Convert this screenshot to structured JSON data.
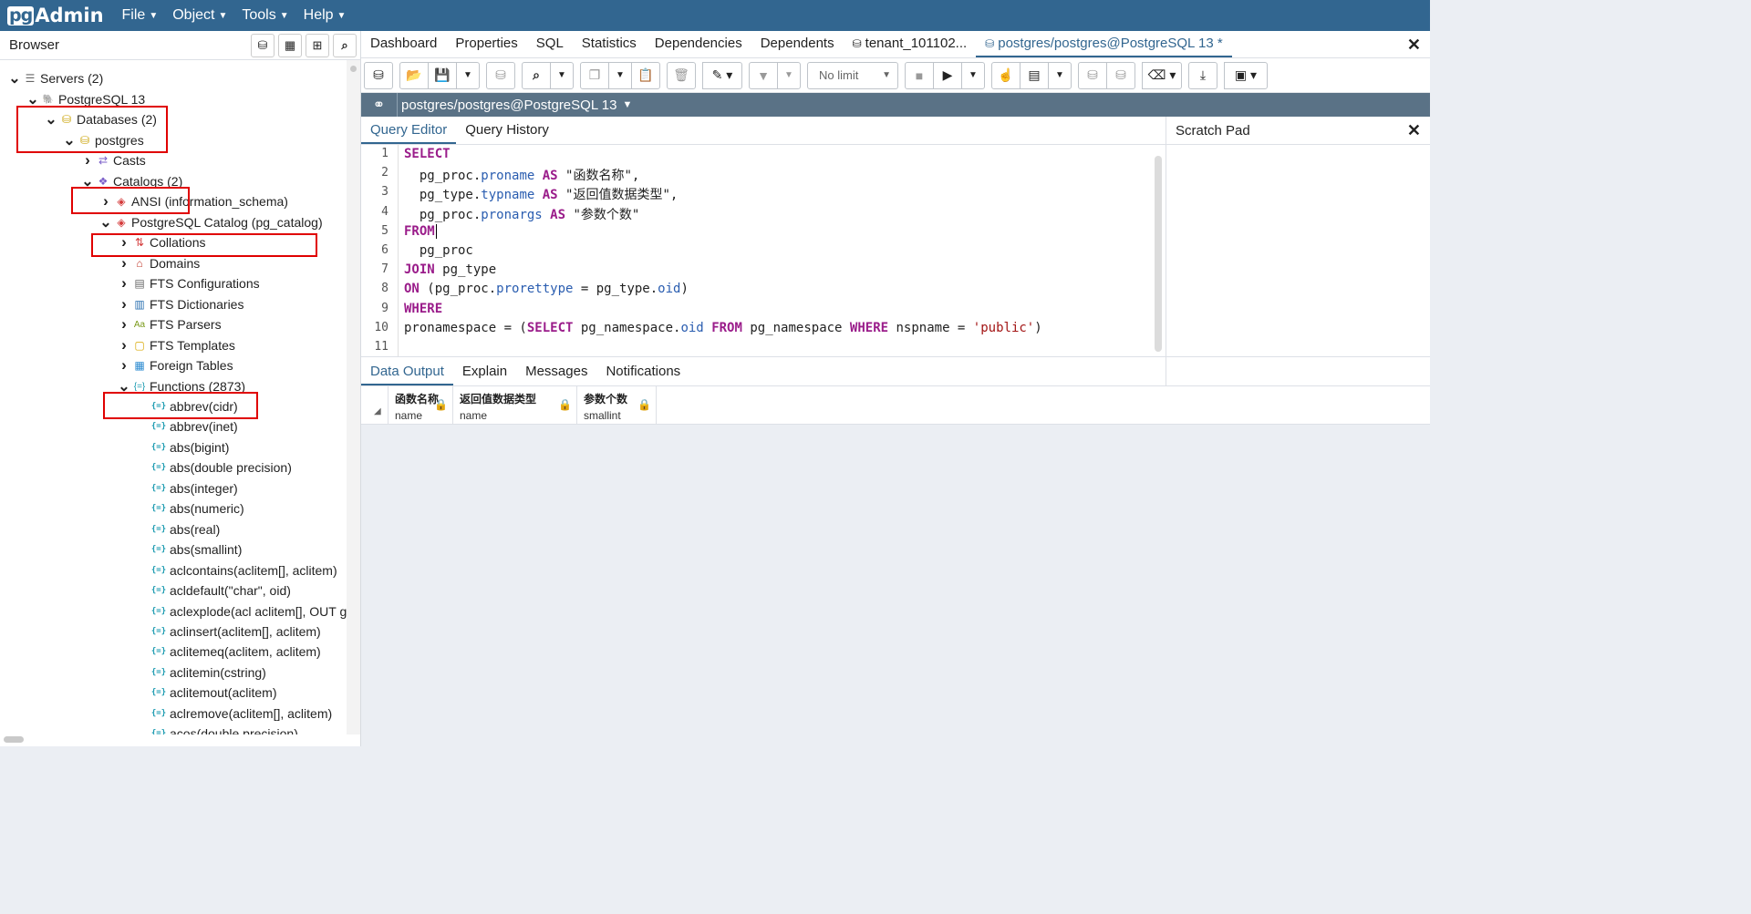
{
  "navbar": {
    "logo_pg": "pg",
    "logo_admin": "Admin",
    "menus": [
      "File",
      "Object",
      "Tools",
      "Help"
    ]
  },
  "browser": {
    "title": "Browser",
    "tree": [
      {
        "label": "Servers (2)",
        "icon": "servers-icon",
        "toggle": "expanded"
      },
      {
        "label": "PostgreSQL 13",
        "icon": "elephant-icon",
        "toggle": "expanded"
      },
      {
        "label": "Databases (2)",
        "icon": "databases-icon",
        "toggle": "expanded"
      },
      {
        "label": "postgres",
        "icon": "database-icon",
        "toggle": "expanded"
      },
      {
        "label": "Casts",
        "icon": "casts-icon",
        "toggle": "collapsed"
      },
      {
        "label": "Catalogs (2)",
        "icon": "catalogs-icon",
        "toggle": "expanded"
      },
      {
        "label": "ANSI (information_schema)",
        "icon": "catalog-icon",
        "toggle": "collapsed"
      },
      {
        "label": "PostgreSQL Catalog (pg_catalog)",
        "icon": "catalog-icon",
        "toggle": "expanded"
      },
      {
        "label": "Collations",
        "icon": "collations-icon",
        "toggle": "collapsed"
      },
      {
        "label": "Domains",
        "icon": "domains-icon",
        "toggle": "collapsed"
      },
      {
        "label": "FTS Configurations",
        "icon": "fts-configurations-icon",
        "toggle": "collapsed"
      },
      {
        "label": "FTS Dictionaries",
        "icon": "fts-dictionaries-icon",
        "toggle": "collapsed"
      },
      {
        "label": "FTS Parsers",
        "icon": "fts-parsers-icon",
        "toggle": "collapsed"
      },
      {
        "label": "FTS Templates",
        "icon": "fts-templates-icon",
        "toggle": "collapsed"
      },
      {
        "label": "Foreign Tables",
        "icon": "foreign-tables-icon",
        "toggle": "collapsed"
      },
      {
        "label": "Functions (2873)",
        "icon": "functions-icon",
        "toggle": "expanded"
      }
    ],
    "functions": [
      "abbrev(cidr)",
      "abbrev(inet)",
      "abs(bigint)",
      "abs(double precision)",
      "abs(integer)",
      "abs(numeric)",
      "abs(real)",
      "abs(smallint)",
      "aclcontains(aclitem[], aclitem)",
      "acldefault(\"char\", oid)",
      "aclexplode(acl aclitem[], OUT gra",
      "aclinsert(aclitem[], aclitem)",
      "aclitemeq(aclitem, aclitem)",
      "aclitemin(cstring)",
      "aclitemout(aclitem)",
      "aclremove(aclitem[], aclitem)",
      "acos(double precision)"
    ]
  },
  "tabs": [
    "Dashboard",
    "Properties",
    "SQL",
    "Statistics",
    "Dependencies",
    "Dependents",
    "tenant_101102...",
    "postgres/postgres@PostgreSQL 13 *"
  ],
  "toolbar": {
    "row_limit": "No limit"
  },
  "connection": {
    "label": "postgres/postgres@PostgreSQL 13"
  },
  "editor_tabs": [
    "Query Editor",
    "Query History"
  ],
  "scratch_pad": {
    "title": "Scratch Pad"
  },
  "code": {
    "lines": [
      [
        {
          "t": "SELECT",
          "c": "kw"
        }
      ],
      [
        {
          "t": "  pg_proc."
        },
        {
          "t": "proname",
          "c": "fld"
        },
        {
          "t": " "
        },
        {
          "t": "AS",
          "c": "kw"
        },
        {
          "t": " \"函数名称\","
        }
      ],
      [
        {
          "t": "  pg_type."
        },
        {
          "t": "typname",
          "c": "fld"
        },
        {
          "t": " "
        },
        {
          "t": "AS",
          "c": "kw"
        },
        {
          "t": " \"返回值数据类型\","
        }
      ],
      [
        {
          "t": "  pg_proc."
        },
        {
          "t": "pronargs",
          "c": "fld"
        },
        {
          "t": " "
        },
        {
          "t": "AS",
          "c": "kw"
        },
        {
          "t": " \"参数个数\""
        }
      ],
      [
        {
          "t": "FROM",
          "c": "kw"
        }
      ],
      [
        {
          "t": "  pg_proc"
        }
      ],
      [
        {
          "t": "JOIN",
          "c": "kw"
        },
        {
          "t": " pg_type"
        }
      ],
      [
        {
          "t": "ON",
          "c": "kw"
        },
        {
          "t": " (pg_proc."
        },
        {
          "t": "prorettype",
          "c": "fld"
        },
        {
          "t": " = pg_type."
        },
        {
          "t": "oid",
          "c": "fld"
        },
        {
          "t": ")"
        }
      ],
      [
        {
          "t": "WHERE",
          "c": "kw"
        }
      ],
      [
        {
          "t": "pronamespace = ("
        },
        {
          "t": "SELECT",
          "c": "kw"
        },
        {
          "t": " pg_namespace."
        },
        {
          "t": "oid",
          "c": "fld"
        },
        {
          "t": " "
        },
        {
          "t": "FROM",
          "c": "kw"
        },
        {
          "t": " pg_namespace "
        },
        {
          "t": "WHERE",
          "c": "kw"
        },
        {
          "t": " nspname = "
        },
        {
          "t": "'public'",
          "c": "sq"
        },
        {
          "t": ")"
        }
      ],
      []
    ]
  },
  "output_tabs": [
    "Data Output",
    "Explain",
    "Messages",
    "Notifications"
  ],
  "grid": {
    "columns": [
      {
        "name": "函数名称",
        "type": "name"
      },
      {
        "name": "返回值数据类型",
        "type": "name"
      },
      {
        "name": "参数个数",
        "type": "smallint"
      }
    ]
  },
  "colors": {
    "navbar": "#326690",
    "highlight_box": "#e00000",
    "keyword": "#9a1c8a",
    "field": "#2a5db0"
  }
}
